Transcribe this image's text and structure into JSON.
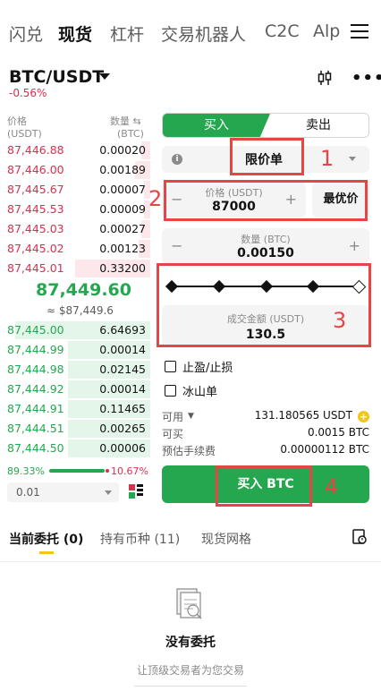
{
  "top_tabs": [
    "闪兑",
    "现货",
    "杠杆",
    "交易机器人",
    "C2C",
    "Alp"
  ],
  "pair": {
    "symbol": "BTC/USDT",
    "change": "-0.56%"
  },
  "order_book": {
    "price_header": "价格",
    "price_unit": "(USDT)",
    "qty_header": "数量 ⇆",
    "qty_unit": "(BTC)",
    "asks": [
      {
        "price": "87,446.88",
        "qty": "0.00020",
        "depth": 0.06
      },
      {
        "price": "87,446.00",
        "qty": "0.00189",
        "depth": 0.1
      },
      {
        "price": "87,445.67",
        "qty": "0.00007",
        "depth": 0.04
      },
      {
        "price": "87,445.53",
        "qty": "0.00009",
        "depth": 0.04
      },
      {
        "price": "87,445.03",
        "qty": "0.00027",
        "depth": 0.06
      },
      {
        "price": "87,445.02",
        "qty": "0.00123",
        "depth": 0.08
      },
      {
        "price": "87,445.01",
        "qty": "0.33200",
        "depth": 0.5
      }
    ],
    "mid_price": "87,449.60",
    "mid_fiat": "≈ $87,449.6",
    "bids": [
      {
        "price": "87,445.00",
        "qty": "6.64693",
        "depth": 0.9
      },
      {
        "price": "87,444.99",
        "qty": "0.00014",
        "depth": 0.55
      },
      {
        "price": "87,444.98",
        "qty": "0.02145",
        "depth": 0.55
      },
      {
        "price": "87,444.92",
        "qty": "0.00014",
        "depth": 0.55
      },
      {
        "price": "87,444.91",
        "qty": "0.11465",
        "depth": 0.55
      },
      {
        "price": "87,444.51",
        "qty": "0.00265",
        "depth": 0.55
      },
      {
        "price": "87,444.50",
        "qty": "0.00006",
        "depth": 0.55
      }
    ],
    "buy_ratio": "89.33%",
    "sell_ratio": "10.67%",
    "depth_value": "0.01"
  },
  "order_panel": {
    "buy_tab": "买入",
    "sell_tab": "卖出",
    "order_type": "限价单",
    "price_label": "价格 (USDT)",
    "price_value": "87000",
    "best_price": "最优价",
    "qty_label": "数量 (BTC)",
    "qty_value": "0.00150",
    "amount_label": "成交金额 (USDT)",
    "amount_value": "130.5",
    "tp_sl": "止盈/止损",
    "iceberg": "冰山单",
    "available_label": "可用",
    "available_value": "131.180565 USDT",
    "can_buy_label": "可买",
    "can_buy_value": "0.0015 BTC",
    "fee_label": "预估手续费",
    "fee_value": "0.00000112 BTC",
    "buy_button": "买入 BTC"
  },
  "annotations": [
    "1",
    "2",
    "3",
    "4"
  ],
  "bottom_tabs": [
    "当前委托 (0)",
    "持有币种 (11)",
    "现货网格"
  ],
  "empty_state": {
    "title": "没有委托",
    "subtitle": "让顶级交易者为您交易"
  },
  "colors": {
    "buy": "#25a750",
    "sell": "#d9304f",
    "annotation": "#e64545",
    "accent": "#f5c518"
  }
}
